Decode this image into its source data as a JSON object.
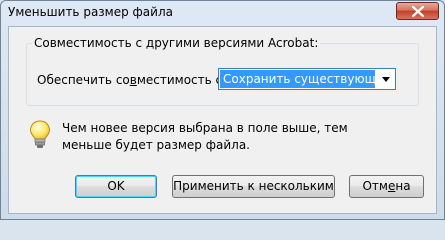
{
  "window": {
    "title": "Уменьшить размер файла"
  },
  "group": {
    "title": "Совместимость с другими версиями Acrobat:",
    "compat_label_prefix": "Обеспечить со",
    "compat_label_mnemonic": "в",
    "compat_label_suffix": "местимость с:",
    "select_value": "Сохранить существующее"
  },
  "info": {
    "text": "Чем новее версия выбрана в поле выше, тем меньше будет размер файла."
  },
  "buttons": {
    "ok": "OK",
    "apply": "Применить к нескольким",
    "cancel_prefix": "Отм",
    "cancel_mnemonic": "е",
    "cancel_suffix": "на"
  }
}
